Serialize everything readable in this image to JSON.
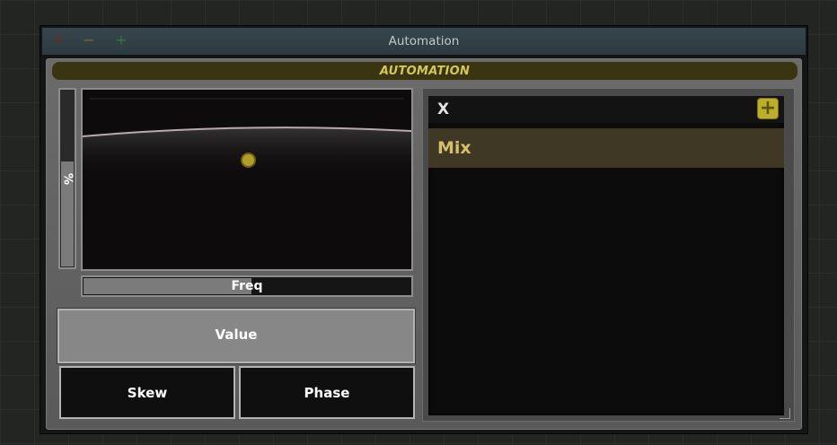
{
  "window": {
    "title": "Automation",
    "controls": {
      "close": "✕",
      "minimize": "−",
      "maximize": "+"
    }
  },
  "header": {
    "label": "AUTOMATION"
  },
  "vertical_slider": {
    "label": "%",
    "level_fraction": 0.59
  },
  "xy_pad": {
    "handle_color": "#b39e2a"
  },
  "horizontal_slider": {
    "label": "Freq",
    "level_fraction": 0.51
  },
  "buttons": {
    "value": "Value",
    "skew": "Skew",
    "phase": "Phase"
  },
  "list": {
    "header": "X",
    "add_icon": "plus-icon",
    "add_symbol": "+",
    "items": [
      {
        "label": "Mix"
      }
    ]
  },
  "colors": {
    "accent": "#d4c75a",
    "selected_item_bg": "#3f3825",
    "selected_item_text": "#d4bf6a",
    "titlebar": "#2f3e45"
  }
}
